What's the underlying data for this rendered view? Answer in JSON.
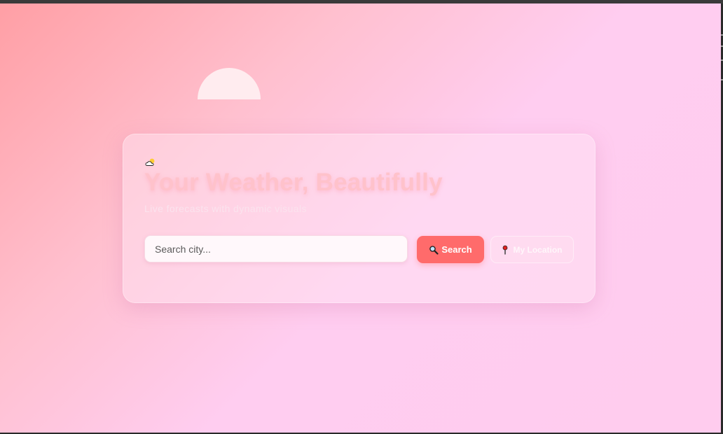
{
  "header": {
    "title": "Your Weather, Beautifully",
    "subtitle": "Live forecasts with dynamic visuals"
  },
  "search": {
    "placeholder": "Search city...",
    "value": "",
    "button_label": "Search",
    "location_button_label": "My Location"
  },
  "icons": {
    "header": "cloud-sun-icon",
    "search_button": "magnifier-icon",
    "location_button": "pin-icon"
  },
  "colors": {
    "accent": "#ff6b6b",
    "title": "#ffc2cb",
    "background_start": "#ff9fa5",
    "background_end": "#ffccee"
  }
}
